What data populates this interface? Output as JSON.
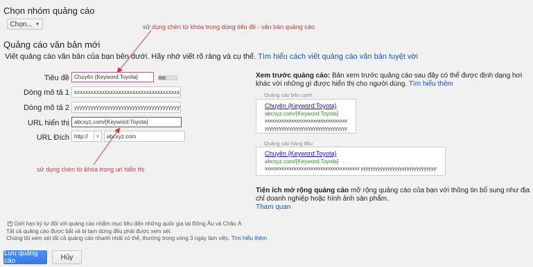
{
  "group": {
    "title": "Chọn nhóm quảng cáo",
    "choose_button": "Chọn..."
  },
  "new_ad": {
    "title": "Quảng cáo văn bản mới",
    "intro": "Viết quảng cáo văn bản của bạn bên dưới. Hãy nhớ viết rõ ràng và cụ thể.",
    "intro_link": "Tìm hiểu cách viết quảng cáo văn bản tuyệt vời"
  },
  "form": {
    "headline_label": "Tiêu đề",
    "headline_value": "Chuyên {Keyword:Toyota}",
    "desc1_label": "Dòng mô tả 1",
    "desc1_value": "xxxxxxxxxxxxxxxxxxxxxxxxxxxxxxxxxxxxxxx",
    "desc2_label": "Dòng mô tả 2",
    "desc2_value": "yyyyyyyyyyyyyyyyyyyyyyyyyyyyyyyyyyyyyyyy",
    "display_url_label": "URL hiển thị",
    "display_url_value": "abcxyz.com/{Keyword:Toyota}",
    "dest_url_label": "URL Đích",
    "protocol_value": "http://",
    "dest_url_value": "abcxyz.com",
    "headline_meter_fill": 0.4
  },
  "annotations": {
    "top": "sử dụng chèn từ khóa trong dòng tiêu đề - văn bản quảng cáo",
    "bottom": "sử dụng chèn từ khóa trong url hiển thị"
  },
  "preview": {
    "heading": "Xem trước quảng cáo:",
    "heading_text": "Bản xem trước quảng cáo sau đây có thể được định dạng hơi khác với những gì được hiển thị cho người dùng.",
    "heading_link": "Tìm hiểu thêm",
    "side_label": "Quảng cáo bên cạnh",
    "side_title": "Chuyên {Keyword:Toyota}",
    "side_url": "abcxyz.com/{Keyword:Toyota}",
    "side_line1": "xxxxxxxxxxxxxxxxxxxxxxxxxxxxxxxxxxxxxxx",
    "side_line2": "yyyyyyyyyyyyyyyyyyyyyyyyyyyyyyyyyyyy",
    "top_label": "Quảng cáo hàng đầu",
    "top_title": "Chuyên {Keyword:Toyota}",
    "top_url": "abcxyz.com/{Keyword:Toyota}",
    "top_line": "xxxxxxxxxxxxxxxxxxxxxxxxxxxxxxxxxxxxxxx yyyyyyyyyyyyyyyyyyyyyyyyyyyyyyyyyyyyy",
    "ext_heading": "Tiện ích mở rộng quảng cáo",
    "ext_text": "mở rộng quảng cáo của bạn với thông tin bổ sung như địa chỉ doanh nghiệp hoặc hình ảnh sản phẩm.",
    "ext_link": "Tham quan"
  },
  "notes": {
    "limit": "Giới hạn ký tự đối với quảng cáo nhắm mục tiêu đến những quốc gia tại Đông Âu và Châu Á",
    "line2": "Tất cả quảng cáo được bắt và bị tạm dừng đều phải được xem xét.",
    "line3": "Chúng tôi xem xét tất cả quảng cáo nhanh nhất có thể, thường trong vòng 3 ngày làm việc.",
    "line3_link": "Tìm hiểu thêm"
  },
  "buttons": {
    "save": "Lưu quảng cáo",
    "cancel": "Hủy"
  },
  "colors": {
    "accent": "#4d90fe",
    "annotation": "#e03030",
    "link": "#1155cc"
  }
}
